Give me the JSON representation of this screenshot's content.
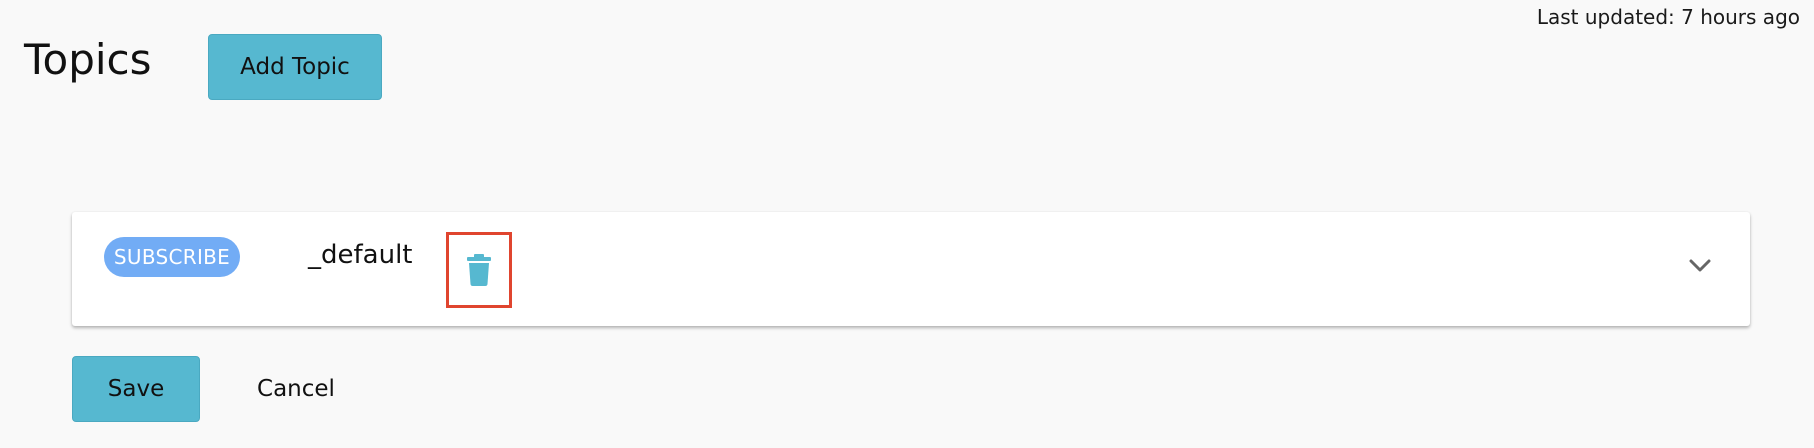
{
  "header": {
    "title": "Topics",
    "add_topic_label": "Add Topic",
    "last_updated": "Last updated: 7 hours ago"
  },
  "topics": [
    {
      "badge": "SUBSCRIBE",
      "name": "_default",
      "delete_icon": "trash-icon",
      "expand_icon": "chevron-down-icon"
    }
  ],
  "actions": {
    "save_label": "Save",
    "cancel_label": "Cancel"
  },
  "colors": {
    "primary_button": "#56b8d0",
    "badge": "#72acf5",
    "trash_icon": "#56b8d0",
    "highlight_border": "#e0452f",
    "background": "#f9f9f9"
  }
}
